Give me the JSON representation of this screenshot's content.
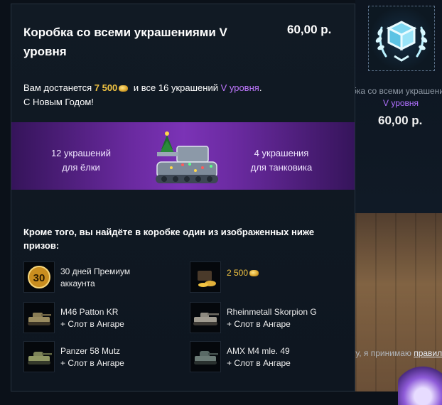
{
  "background": {
    "product_title": "Коробка со всеми украшениями V уровня",
    "product_level": "V уровня",
    "product_price": "60,00 р.",
    "rules_prefix": "кнопку, я принимаю ",
    "rules_link": "правила",
    "rules_suffix": "."
  },
  "tooltip": {
    "title": "Коробка со всеми украшениями V уровня",
    "price": "60,00 р.",
    "desc_part1": "Вам достанется ",
    "gold_amount": "7 500",
    "desc_part2": " и все 16 украшений ",
    "level": "V уровня",
    "desc_part3": ".",
    "greeting": "С Новым Годом!",
    "banner_left_line1": "12 украшений",
    "banner_left_line2": "для ёлки",
    "banner_right_line1": "4 украшения",
    "banner_right_line2": "для танковика",
    "extra": "Кроме того, вы найдёте в коробке один из изображенных ниже призов:",
    "prizes": [
      {
        "line1": "30 дней Премиум",
        "line2": "аккаунта",
        "icon": "premium-30-icon"
      },
      {
        "line1": "2 500",
        "line2": "",
        "icon": "gold-chest-icon"
      },
      {
        "line1": "M46 Patton KR",
        "line2": "+ Слот в Ангаре",
        "icon": "tank-m46-icon"
      },
      {
        "line1": "Rheinmetall Skorpion G",
        "line2": "+ Слот в Ангаре",
        "icon": "tank-skorpion-icon"
      },
      {
        "line1": "Panzer 58 Mutz",
        "line2": "+ Слот в Ангаре",
        "icon": "tank-panzer58-icon"
      },
      {
        "line1": "AMX M4 mle. 49",
        "line2": "+ Слот в Ангаре",
        "icon": "tank-amx-icon"
      }
    ]
  },
  "colors": {
    "gold": "#f3c542",
    "purple": "#c078ff",
    "banner": "#6a2aa0"
  }
}
